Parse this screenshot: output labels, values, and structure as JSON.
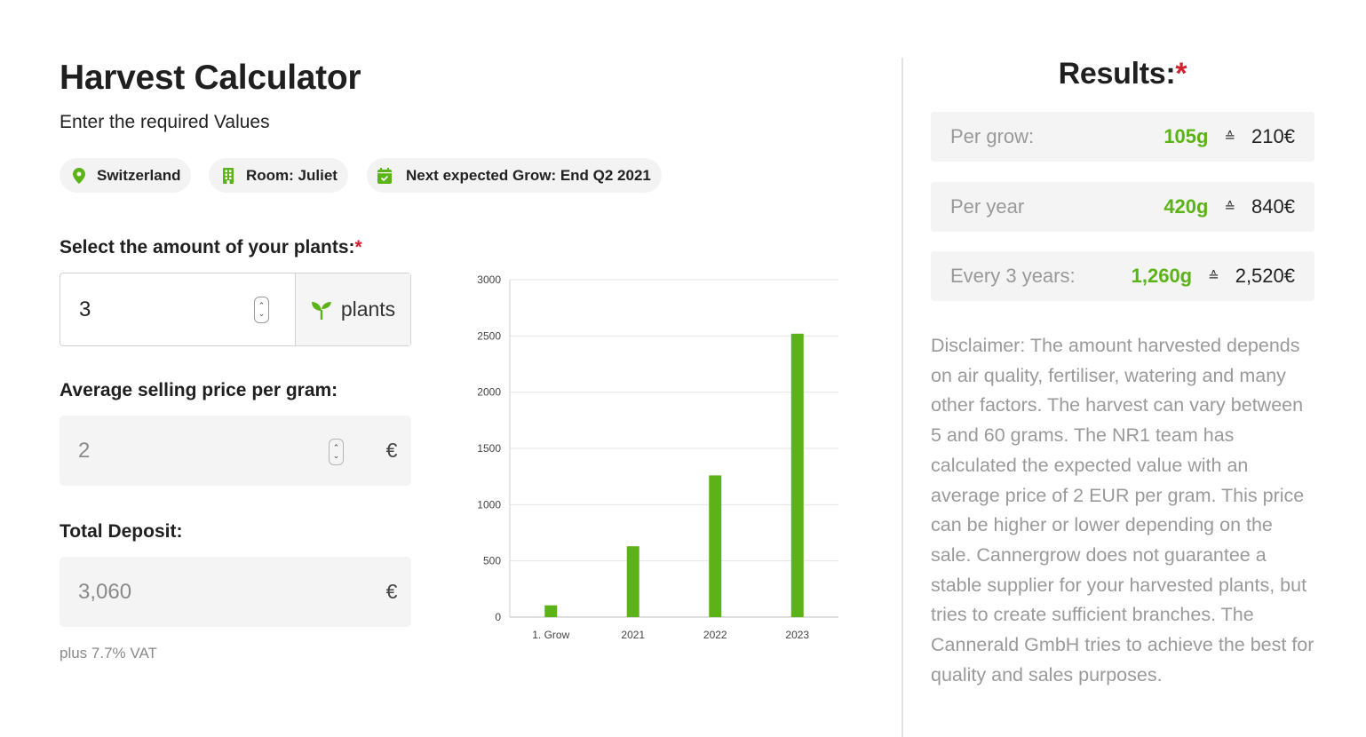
{
  "header": {
    "title": "Harvest Calculator",
    "subtitle": "Enter the required Values"
  },
  "pills": {
    "location": "Switzerland",
    "room": "Room: Juliet",
    "next_grow": "Next expected Grow: End Q2 2021"
  },
  "form": {
    "plants_label": "Select the amount of your plants:",
    "required_mark": "*",
    "plants_value": "3",
    "plants_unit": "plants",
    "price_label": "Average selling price per gram:",
    "price_value": "2",
    "price_currency": "€",
    "deposit_label": "Total Deposit:",
    "deposit_value": "3,060",
    "deposit_currency": "€",
    "vat_note": "plus 7.7% VAT"
  },
  "chart_data": {
    "type": "bar",
    "categories": [
      "1. Grow",
      "2021",
      "2022",
      "2023"
    ],
    "values": [
      105,
      630,
      1260,
      2520
    ],
    "ylim": [
      0,
      3000
    ],
    "yticks": [
      0,
      500,
      1000,
      1500,
      2000,
      2500,
      3000
    ],
    "grid": true,
    "color": "#5cb318"
  },
  "results": {
    "title": "Results:",
    "required_mark": "*",
    "equiv_symbol": "≙",
    "rows": [
      {
        "label": "Per grow:",
        "grams": "105g",
        "money": "210€"
      },
      {
        "label": "Per year",
        "grams": "420g",
        "money": "840€"
      },
      {
        "label": "Every 3 years:",
        "grams": "1,260g",
        "money": "2,520€"
      }
    ],
    "disclaimer": "Disclaimer: The amount harvested depends on air quality, fertiliser, watering and many other factors. The harvest can vary between 5 and 60 grams. The NR1 team has calculated the expected value with an average price of 2 EUR per gram. This price can be higher or lower depending on the sale. Cannergrow does not guarantee a stable supplier for your harvested plants, but tries to create sufficient branches. The Cannerald GmbH tries to achieve the best for quality and sales purposes."
  },
  "colors": {
    "accent": "#5cb318",
    "required": "#d0212f",
    "muted_text": "#9a9a9a"
  },
  "icons": {
    "location": "map-pin-icon",
    "room": "building-icon",
    "calendar": "calendar-check-icon",
    "plant": "sprout-icon"
  }
}
